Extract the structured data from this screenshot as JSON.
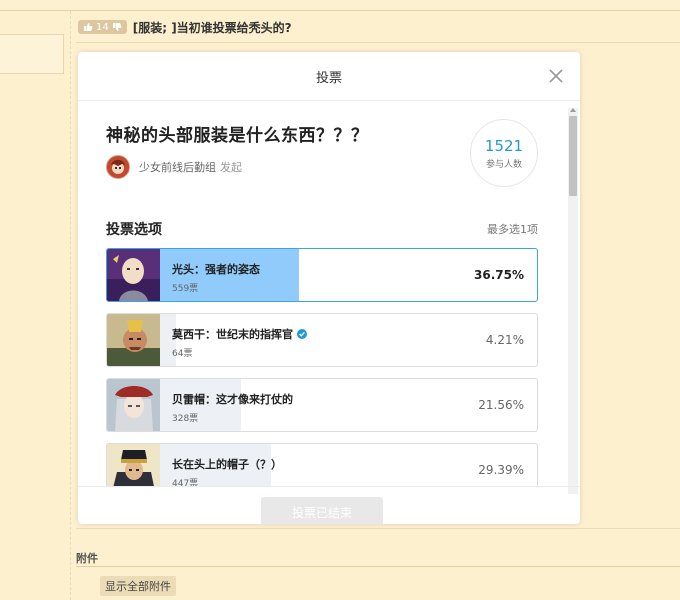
{
  "post": {
    "like_count": "14",
    "title": "[服装; ]当初谁投票给秃头的?"
  },
  "attachments": {
    "label": "附件",
    "show_all": "显示全部附件"
  },
  "modal": {
    "title": "投票",
    "question": "神秘的头部服装是什么东西？？？",
    "author": "少女前线后勤组",
    "author_action": "发起",
    "participants": "1521",
    "participants_label": "参与人数",
    "section_title": "投票选项",
    "max_choice": "最多选1项",
    "options": [
      {
        "label": "光头：强者的姿态",
        "votes": "559票",
        "percent": "36.75%",
        "fraction": 0.3675,
        "selected": true
      },
      {
        "label": "莫西干：世纪末的指挥官",
        "votes": "64票",
        "percent": "4.21%",
        "fraction": 0.0421,
        "selected": false
      },
      {
        "label": "贝雷帽：这才像来打仗的",
        "votes": "328票",
        "percent": "21.56%",
        "fraction": 0.2156,
        "selected": false
      },
      {
        "label": "长在头上的帽子（？）",
        "votes": "447票",
        "percent": "29.39%",
        "fraction": 0.2939,
        "selected": false
      }
    ],
    "footer_button": "投票已结束"
  },
  "colors": {
    "accent": "#1e9ad6",
    "selected_fill": "#90cbfb",
    "background": "#fdf0cf"
  }
}
